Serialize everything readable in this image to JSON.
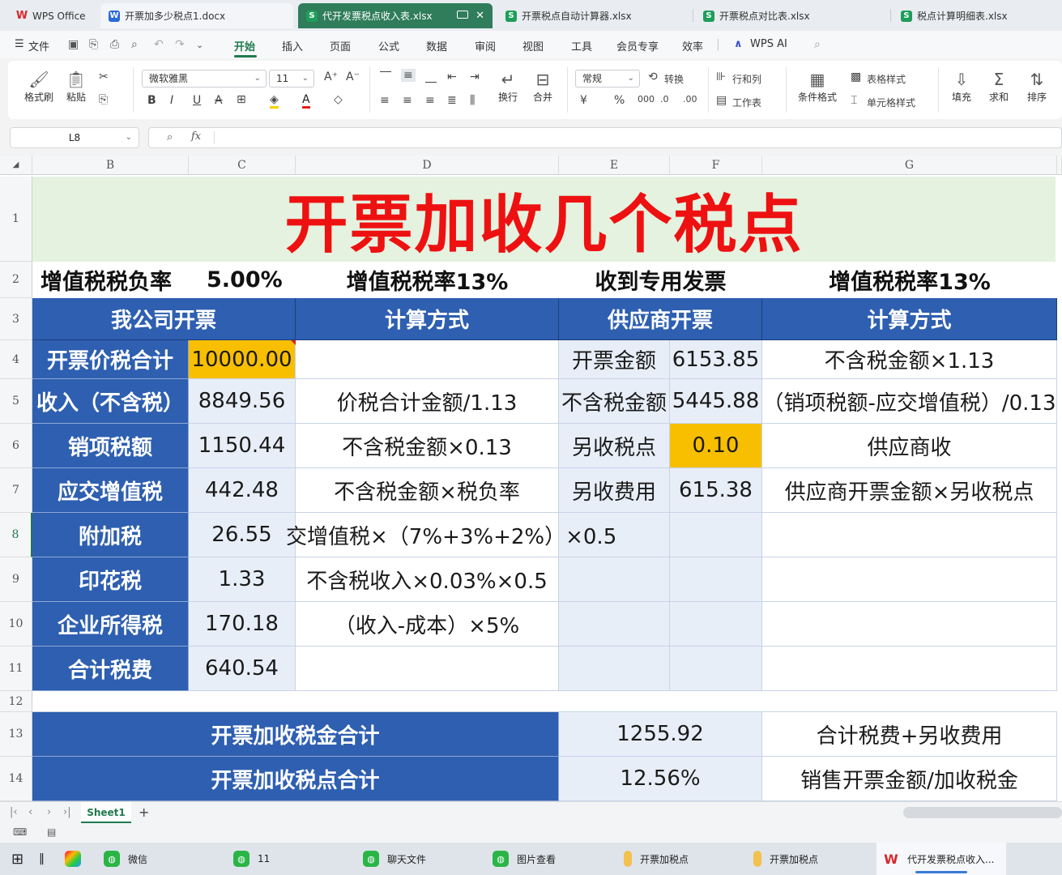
{
  "tabs": [
    {
      "icon": "wps-logo-icon",
      "label": "WPS Office"
    },
    {
      "icon": "word-doc-icon",
      "label": "开票加多少税点1.docx"
    },
    {
      "icon": "sheet-icon",
      "label": "代开发票税点收入表.xlsx",
      "active": true
    },
    {
      "icon": "sheet-icon",
      "label": "开票税点自动计算器.xlsx"
    },
    {
      "icon": "sheet-icon",
      "label": "开票税点对比表.xlsx"
    },
    {
      "icon": "sheet-icon",
      "label": "税点计算明细表.xlsx"
    }
  ],
  "menu": {
    "file": "文件",
    "items": [
      "开始",
      "插入",
      "页面",
      "公式",
      "数据",
      "审阅",
      "视图",
      "工具",
      "会员专享",
      "效率"
    ],
    "active": "开始",
    "wps_ai": "WPS AI"
  },
  "ribbon": {
    "format_painter": "格式刷",
    "paste": "粘贴",
    "font_name": "微软雅黑",
    "font_size": "11",
    "wrap": "换行",
    "merge": "合并",
    "number_format": "常规",
    "convert": "转换",
    "row_col": "行和列",
    "worksheet": "工作表",
    "cond_format": "条件格式",
    "table_style": "表格样式",
    "cell_style": "单元格样式",
    "fill": "填充",
    "sum": "求和",
    "sort": "排序"
  },
  "formula_bar": {
    "name_box": "L8",
    "fx": "fx",
    "content": ""
  },
  "columns": [
    "B",
    "C",
    "D",
    "E",
    "F",
    "G"
  ],
  "rows": [
    "1",
    "2",
    "3",
    "4",
    "5",
    "6",
    "7",
    "8",
    "9",
    "10",
    "11",
    "12",
    "13",
    "14"
  ],
  "sheet": {
    "title": "开票加收几个税点",
    "row2": {
      "tax_burden_label": "增值税税负率",
      "tax_burden_value": "5.00%",
      "vat_rate_1": "增值税税率13%",
      "special_invoice": "收到专用发票",
      "vat_rate_2": "增值税税率13%"
    },
    "headers": [
      "我公司开票",
      "计算方式",
      "供应商开票",
      "计算方式"
    ],
    "left_rows": [
      {
        "label": "开票价税合计",
        "value": "10000.00",
        "method": ""
      },
      {
        "label": "收入（不含税）",
        "value": "8849.56",
        "method": "价税合计金额/1.13"
      },
      {
        "label": "销项税额",
        "value": "1150.44",
        "method": "不含税金额×0.13"
      },
      {
        "label": "应交增值税",
        "value": "442.48",
        "method": "不含税金额×税负率"
      },
      {
        "label": "附加税",
        "value": "26.55",
        "method": "交增值税×（7%+3%+2%）×0.5"
      },
      {
        "label": "印花税",
        "value": "1.33",
        "method": "不含税收入×0.03%×0.5"
      },
      {
        "label": "企业所得税",
        "value": "170.18",
        "method": "（收入-成本）×5%"
      },
      {
        "label": "合计税费",
        "value": "640.54",
        "method": ""
      }
    ],
    "right_rows": [
      {
        "label": "开票金额",
        "value": "6153.85",
        "method": "不含税金额×1.13"
      },
      {
        "label": "不含税金额",
        "value": "5445.88",
        "method": "（销项税额-应交增值税）/0.13"
      },
      {
        "label": "另收税点",
        "value": "0.10",
        "method": "供应商收"
      },
      {
        "label": "另收费用",
        "value": "615.38",
        "method": "供应商开票金额×另收税点"
      }
    ],
    "summary": [
      {
        "label": "开票加收税金合计",
        "value": "1255.92",
        "method": "合计税费+另收费用"
      },
      {
        "label": "开票加收税点合计",
        "value": "12.56%",
        "method": "销售开票金额/加收税金"
      }
    ]
  },
  "sheet_tab": "Sheet1",
  "taskbar": [
    {
      "label": "微信"
    },
    {
      "label": "11"
    },
    {
      "label": "聊天文件"
    },
    {
      "label": "图片查看"
    },
    {
      "label": "开票加税点"
    },
    {
      "label": "开票加税点"
    },
    {
      "label": "代开发票税点收入..."
    }
  ],
  "colors": {
    "header_blue": "#2e5fb0",
    "value_bg": "#e8eef8",
    "highlight": "#f8bf00",
    "title_red": "#ee1111",
    "title_bg": "#e4f2df",
    "active_tab": "#2f7d5b"
  }
}
